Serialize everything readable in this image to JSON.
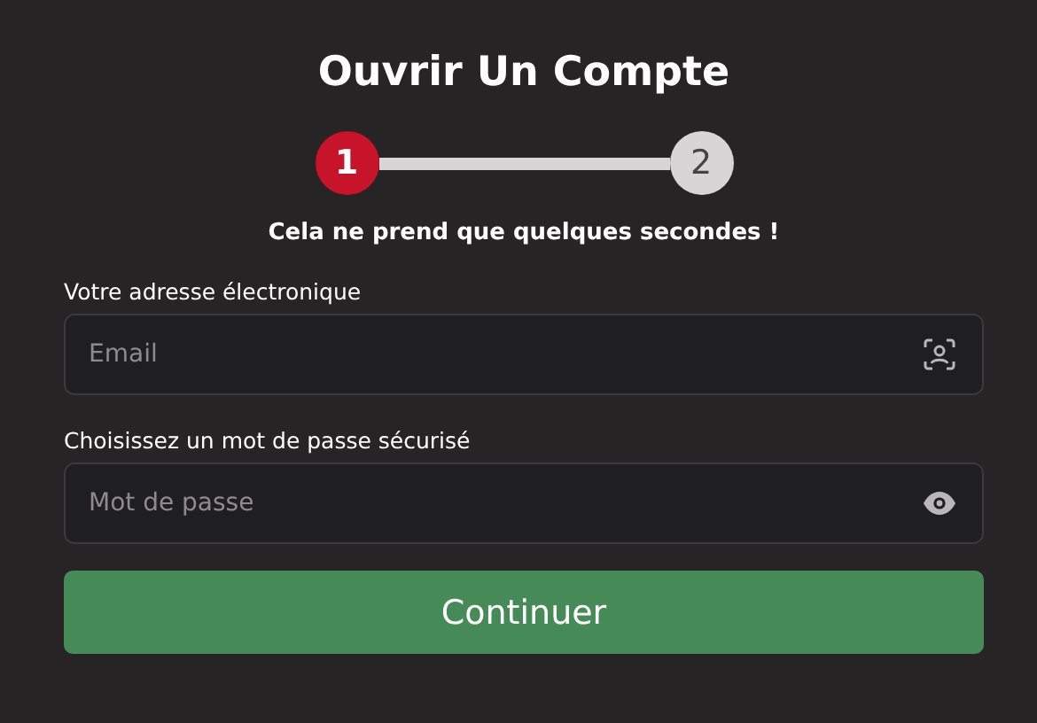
{
  "title": "Ouvrir Un Compte",
  "steps": [
    {
      "label": "1",
      "selected": true
    },
    {
      "label": "2",
      "selected": false
    }
  ],
  "subtitle": "Cela ne prend que quelques secondes !",
  "fields": [
    {
      "kind": "email",
      "label": "Votre adresse électronique",
      "placeholder": "Email"
    },
    {
      "kind": "password",
      "label": "Choisissez un mot de passe sécurisé",
      "placeholder": "Mot de passe"
    }
  ],
  "submit": "Continuer"
}
